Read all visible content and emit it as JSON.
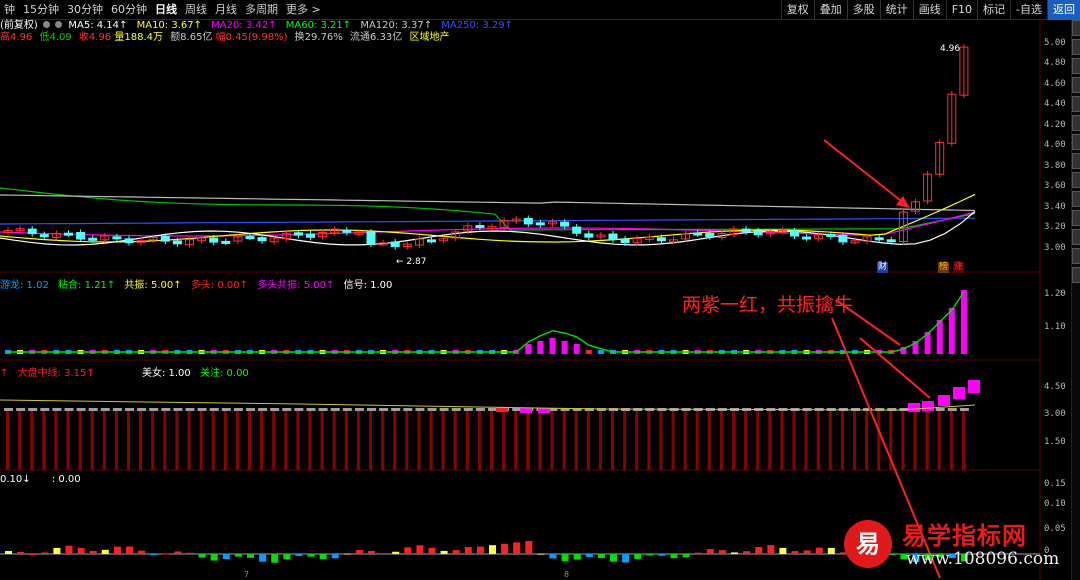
{
  "toolbar": {
    "periods": [
      "钟",
      "15分钟",
      "30分钟",
      "60分钟",
      "日线",
      "周线",
      "月线",
      "多周期",
      "更多 >"
    ],
    "active_period": "日线",
    "buttons": [
      "复权",
      "叠加",
      "多股",
      "统计",
      "画线",
      "F10",
      "标记",
      "-自选",
      "返回"
    ]
  },
  "ma_line": {
    "prefix": "(前复权)",
    "items": [
      {
        "text": "MA5: 4.14↑",
        "color": "#ffffff"
      },
      {
        "text": "MA10: 3.67↑",
        "color": "#ffff00"
      },
      {
        "text": "MA20: 3.42↑",
        "color": "#ff00ff"
      },
      {
        "text": "MA60: 3.21↑",
        "color": "#00ff00"
      },
      {
        "text": "MA120: 3.37↑",
        "color": "#c8c8c8"
      },
      {
        "text": "MA250: 3.29↑",
        "color": "#3050ff"
      }
    ]
  },
  "quote_line": [
    {
      "text": "高4.96",
      "color": "#ff3030"
    },
    {
      "text": "低4.09",
      "color": "#00d000"
    },
    {
      "text": "收4.96",
      "color": "#ff3030"
    },
    {
      "text": "量188.4万",
      "color": "#ffff00"
    },
    {
      "text": "额8.65亿",
      "color": "#c8c8c8"
    },
    {
      "text": "幅0.45(9.98%)",
      "color": "#ff3030"
    },
    {
      "text": "换29.76%",
      "color": "#c8c8c8"
    },
    {
      "text": "流通6.33亿",
      "color": "#c8c8c8"
    },
    {
      "text": "区域地产",
      "color": "#ffff00"
    }
  ],
  "main_chart": {
    "high_label": "4.96",
    "low_label": "← 2.87",
    "axis": [
      "5.00",
      "4.80",
      "4.60",
      "4.40",
      "4.20",
      "4.00",
      "3.80",
      "3.60",
      "3.40",
      "3.20",
      "3.00"
    ],
    "badges": {
      "cai": "财",
      "bang": "榜",
      "zhang": "涨"
    }
  },
  "indicator1": {
    "labels": [
      {
        "text": "游龙: 1.02",
        "color": "#00a0ff"
      },
      {
        "text": "粘合: 1.21↑",
        "color": "#00ff00"
      },
      {
        "text": "共振: 5.00↑",
        "color": "#ffff00"
      },
      {
        "text": "多头: 0.00↑",
        "color": "#ff2020"
      },
      {
        "text": "多头共振: 5.00↑",
        "color": "#ff00ff"
      },
      {
        "text": "信号: 1.00",
        "color": "#ffffff"
      }
    ],
    "axis": [
      "1.20",
      "1.10"
    ],
    "bars": [
      0.0,
      0.0,
      0.0,
      0.0,
      0.0,
      0.0,
      0.0,
      0.0,
      0.0,
      0.0,
      0.0,
      0.0,
      0.0,
      0.0,
      0.0,
      0.0,
      0.0,
      0.0,
      0.0,
      0.0,
      0.0,
      0.0,
      0.0,
      0.0,
      0.0,
      0.0,
      0.0,
      0.0,
      0.0,
      0.0,
      0.0,
      0.0,
      0.0,
      0.0,
      0.0,
      0.0,
      0.0,
      0.0,
      0.0,
      0.0,
      0.0,
      0.0,
      0.0,
      0.02,
      0.03,
      0.04,
      0.03,
      0.02,
      0.0,
      0.0,
      0.0,
      0.0,
      0.0,
      0.0,
      0.0,
      0.0,
      0.0,
      0.0,
      0.0,
      0.0,
      0.0,
      0.0,
      0.0,
      0.0,
      0.0,
      0.0,
      0.0,
      0.0,
      0.0,
      0.0,
      0.0,
      0.0,
      0.0,
      0.0,
      0.01,
      0.03,
      0.06,
      0.1,
      0.14,
      0.2
    ]
  },
  "indicator2": {
    "labels": [
      {
        "text": "↑",
        "color": "#ff2020"
      },
      {
        "text": "大盘中线: 3.15↑",
        "color": "#ff2020"
      },
      {
        "text": "美女: 1.00",
        "color": "#ffffff"
      },
      {
        "text": "关注: 0.00",
        "color": "#00ff00"
      }
    ],
    "axis": [
      "4.50",
      "3.00",
      "1.50"
    ]
  },
  "indicator3": {
    "labels": [
      {
        "text": "0.10↓",
        "color": "#ffffff"
      },
      {
        "text": ": 0.00",
        "color": "#ffffff"
      }
    ],
    "axis": [
      "0.15",
      "0.10",
      "0.05",
      "0"
    ]
  },
  "annotation": "两紫一红，共振擒牛",
  "watermark": {
    "logo": "易",
    "title": "易学指标网",
    "url": "www.108096.com"
  },
  "time_axis": [
    "7",
    "8"
  ]
}
